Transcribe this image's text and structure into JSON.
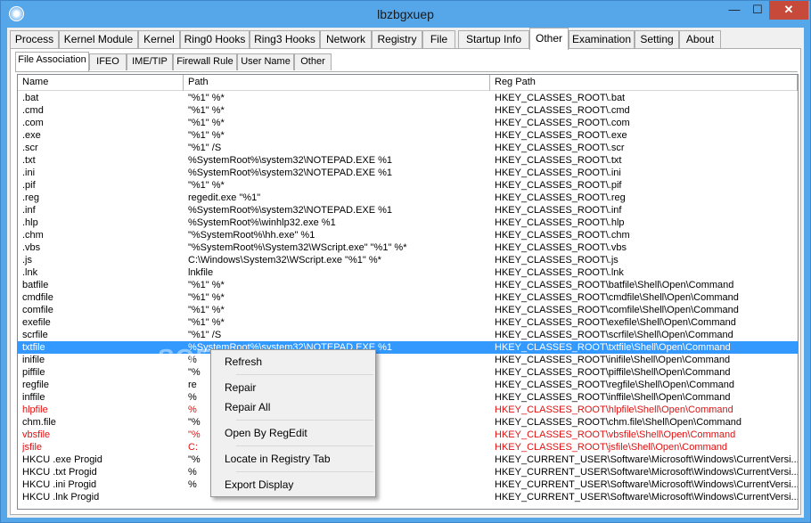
{
  "window": {
    "title": "lbzbgxuep",
    "controls": {
      "minimize": "—",
      "maximize": "☐",
      "close": "✕"
    }
  },
  "main_tabs": [
    {
      "label": "Process",
      "active": false
    },
    {
      "label": "Kernel Module",
      "active": false
    },
    {
      "label": "Kernel",
      "active": false
    },
    {
      "label": "Ring0 Hooks",
      "active": false
    },
    {
      "label": "Ring3 Hooks",
      "active": false
    },
    {
      "label": "Network",
      "active": false
    },
    {
      "label": "Registry",
      "active": false
    },
    {
      "label": "File",
      "active": false
    },
    {
      "label": "Startup Info",
      "active": false
    },
    {
      "label": "Other",
      "active": true
    },
    {
      "label": "Examination",
      "active": false
    },
    {
      "label": "Setting",
      "active": false
    },
    {
      "label": "About",
      "active": false
    }
  ],
  "sub_tabs": [
    {
      "label": "File Association",
      "active": true
    },
    {
      "label": "IFEO",
      "active": false
    },
    {
      "label": "IME/TIP",
      "active": false
    },
    {
      "label": "Firewall Rule",
      "active": false
    },
    {
      "label": "User Name",
      "active": false
    },
    {
      "label": "Other",
      "active": false
    }
  ],
  "table": {
    "columns": [
      "Name",
      "Path",
      "Reg Path"
    ],
    "rows": [
      {
        "name": ".bat",
        "path": "\"%1\" %*",
        "reg": "HKEY_CLASSES_ROOT\\.bat",
        "state": ""
      },
      {
        "name": ".cmd",
        "path": "\"%1\" %*",
        "reg": "HKEY_CLASSES_ROOT\\.cmd",
        "state": ""
      },
      {
        "name": ".com",
        "path": "\"%1\" %*",
        "reg": "HKEY_CLASSES_ROOT\\.com",
        "state": ""
      },
      {
        "name": ".exe",
        "path": "\"%1\" %*",
        "reg": "HKEY_CLASSES_ROOT\\.exe",
        "state": ""
      },
      {
        "name": ".scr",
        "path": "\"%1\" /S",
        "reg": "HKEY_CLASSES_ROOT\\.scr",
        "state": ""
      },
      {
        "name": ".txt",
        "path": "%SystemRoot%\\system32\\NOTEPAD.EXE %1",
        "reg": "HKEY_CLASSES_ROOT\\.txt",
        "state": ""
      },
      {
        "name": ".ini",
        "path": "%SystemRoot%\\system32\\NOTEPAD.EXE %1",
        "reg": "HKEY_CLASSES_ROOT\\.ini",
        "state": ""
      },
      {
        "name": ".pif",
        "path": "\"%1\" %*",
        "reg": "HKEY_CLASSES_ROOT\\.pif",
        "state": ""
      },
      {
        "name": ".reg",
        "path": "regedit.exe \"%1\"",
        "reg": "HKEY_CLASSES_ROOT\\.reg",
        "state": ""
      },
      {
        "name": ".inf",
        "path": "%SystemRoot%\\system32\\NOTEPAD.EXE %1",
        "reg": "HKEY_CLASSES_ROOT\\.inf",
        "state": ""
      },
      {
        "name": ".hlp",
        "path": "%SystemRoot%\\winhlp32.exe %1",
        "reg": "HKEY_CLASSES_ROOT\\.hlp",
        "state": ""
      },
      {
        "name": ".chm",
        "path": "\"%SystemRoot%\\hh.exe\" %1",
        "reg": "HKEY_CLASSES_ROOT\\.chm",
        "state": ""
      },
      {
        "name": ".vbs",
        "path": "\"%SystemRoot%\\System32\\WScript.exe\" \"%1\" %*",
        "reg": "HKEY_CLASSES_ROOT\\.vbs",
        "state": ""
      },
      {
        "name": ".js",
        "path": "C:\\Windows\\System32\\WScript.exe \"%1\" %*",
        "reg": "HKEY_CLASSES_ROOT\\.js",
        "state": ""
      },
      {
        "name": ".lnk",
        "path": "lnkfile",
        "reg": "HKEY_CLASSES_ROOT\\.lnk",
        "state": ""
      },
      {
        "name": "batfile",
        "path": "\"%1\" %*",
        "reg": "HKEY_CLASSES_ROOT\\batfile\\Shell\\Open\\Command",
        "state": ""
      },
      {
        "name": "cmdfile",
        "path": "\"%1\" %*",
        "reg": "HKEY_CLASSES_ROOT\\cmdfile\\Shell\\Open\\Command",
        "state": ""
      },
      {
        "name": "comfile",
        "path": "\"%1\" %*",
        "reg": "HKEY_CLASSES_ROOT\\comfile\\Shell\\Open\\Command",
        "state": ""
      },
      {
        "name": "exefile",
        "path": "\"%1\" %*",
        "reg": "HKEY_CLASSES_ROOT\\exefile\\Shell\\Open\\Command",
        "state": ""
      },
      {
        "name": "scrfile",
        "path": "\"%1\" /S",
        "reg": "HKEY_CLASSES_ROOT\\scrfile\\Shell\\Open\\Command",
        "state": ""
      },
      {
        "name": "txtfile",
        "path": "%SystemRoot%\\system32\\NOTEPAD.EXE %1",
        "reg": "HKEY_CLASSES_ROOT\\txtfile\\Shell\\Open\\Command",
        "state": "selected"
      },
      {
        "name": "inifile",
        "path": "%",
        "reg": "HKEY_CLASSES_ROOT\\inifile\\Shell\\Open\\Command",
        "state": ""
      },
      {
        "name": "piffile",
        "path": "\"%",
        "reg": "HKEY_CLASSES_ROOT\\piffile\\Shell\\Open\\Command",
        "state": ""
      },
      {
        "name": "regfile",
        "path": "re",
        "reg": "HKEY_CLASSES_ROOT\\regfile\\Shell\\Open\\Command",
        "state": ""
      },
      {
        "name": "inffile",
        "path": "%",
        "reg": "HKEY_CLASSES_ROOT\\inffile\\Shell\\Open\\Command",
        "state": ""
      },
      {
        "name": "hlpfile",
        "path": "%",
        "reg": "HKEY_CLASSES_ROOT\\hlpfile\\Shell\\Open\\Command",
        "state": "red"
      },
      {
        "name": "chm.file",
        "path": "\"%",
        "reg": "HKEY_CLASSES_ROOT\\chm.file\\Shell\\Open\\Command",
        "state": ""
      },
      {
        "name": "vbsfile",
        "path": "\"%",
        "reg": "HKEY_CLASSES_ROOT\\vbsfile\\Shell\\Open\\Command",
        "state": "red"
      },
      {
        "name": "jsfile",
        "path": "C:",
        "reg": "HKEY_CLASSES_ROOT\\jsfile\\Shell\\Open\\Command",
        "state": "red"
      },
      {
        "name": "HKCU .exe Progid",
        "path": "\"%",
        "reg": "HKEY_CURRENT_USER\\Software\\Microsoft\\Windows\\CurrentVersi...",
        "state": ""
      },
      {
        "name": "HKCU .txt Progid",
        "path": "%",
        "reg": "HKEY_CURRENT_USER\\Software\\Microsoft\\Windows\\CurrentVersi...",
        "state": ""
      },
      {
        "name": "HKCU .ini Progid",
        "path": "%",
        "reg": "HKEY_CURRENT_USER\\Software\\Microsoft\\Windows\\CurrentVersi...",
        "state": ""
      },
      {
        "name": "HKCU .lnk Progid",
        "path": "",
        "reg": "HKEY_CURRENT_USER\\Software\\Microsoft\\Windows\\CurrentVersi...",
        "state": ""
      }
    ]
  },
  "context_menu": {
    "refresh": "Refresh",
    "repair": "Repair",
    "repair_all": "Repair All",
    "open_by_regedit": "Open By RegEdit",
    "locate_in_registry_tab": "Locate in Registry Tab",
    "export_display": "Export Display"
  },
  "watermark": "SOFTPEDIA",
  "colors": {
    "titlebar": "#56a6ea",
    "close_button": "#c7493a",
    "selection": "#3399ff",
    "warning_text": "#e01010"
  }
}
